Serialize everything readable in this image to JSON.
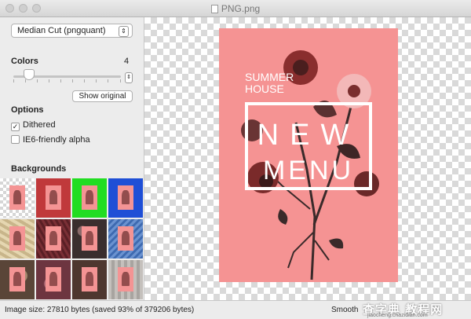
{
  "window": {
    "title": "PNG.png"
  },
  "sidebar": {
    "algorithm_select": "Median Cut (pngquant)",
    "colors_label": "Colors",
    "colors_value": "4",
    "show_original_label": "Show original",
    "options_label": "Options",
    "options": [
      {
        "label": "Dithered",
        "checked": true
      },
      {
        "label": "IE6-friendly alpha",
        "checked": false
      }
    ],
    "backgrounds_label": "Backgrounds",
    "backgrounds": [
      {
        "name": "checkerboard-small",
        "color": "#ffffff"
      },
      {
        "name": "red",
        "color": "#c0393b"
      },
      {
        "name": "green",
        "color": "#22dd22"
      },
      {
        "name": "blue",
        "color": "#1f4fd6"
      },
      {
        "name": "yellow-texture",
        "color": "#d9c8a0"
      },
      {
        "name": "dark-red-texture",
        "color": "#6b2a2e"
      },
      {
        "name": "floral-dark",
        "color": "#4a3a3a"
      },
      {
        "name": "blue-texture",
        "color": "#5d87c9"
      },
      {
        "name": "floral-brown",
        "color": "#7a5a4a"
      },
      {
        "name": "rose-texture",
        "color": "#8d4a55"
      },
      {
        "name": "brown-flowers",
        "color": "#6a4b3f"
      },
      {
        "name": "grey-pattern",
        "color": "#b8b4b0"
      }
    ]
  },
  "poster": {
    "line1": "SUMMER",
    "line2": "HOUSE",
    "word1": "NEW",
    "word2": "MENU",
    "background": "#f59393"
  },
  "status": {
    "image_size": "Image size: 27810 bytes (saved 93% of 379206 bytes)",
    "smooth_scaling": "Smooth sca"
  },
  "watermark": {
    "main": "查字典 教程网",
    "sub": "jiaocheng.chazidian.com"
  }
}
